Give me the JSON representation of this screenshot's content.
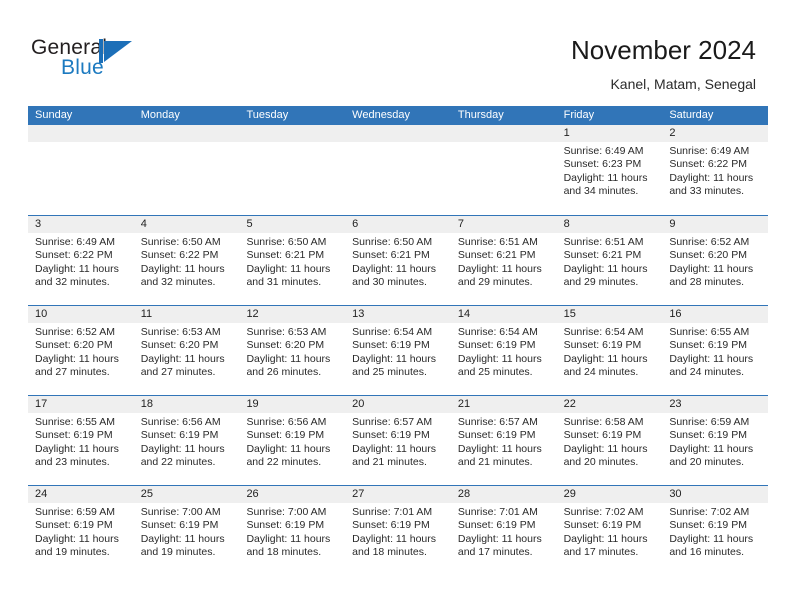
{
  "brand": {
    "name_top": "General",
    "name_bottom": "Blue",
    "mark": "flag-triangle",
    "color_top": "#231f20",
    "color_bottom": "#1c7ac0",
    "accent": "#1c6fb8"
  },
  "header": {
    "title": "November 2024",
    "subtitle": "Kanel, Matam, Senegal",
    "header_bg": "#3175b8",
    "daynum_bg": "#efefef"
  },
  "calendar": {
    "weekday_headers": [
      "Sunday",
      "Monday",
      "Tuesday",
      "Wednesday",
      "Thursday",
      "Friday",
      "Saturday"
    ],
    "weeks": [
      [
        {
          "day": "",
          "sunrise": "",
          "sunset": "",
          "daylight_line1": "",
          "daylight_line2": ""
        },
        {
          "day": "",
          "sunrise": "",
          "sunset": "",
          "daylight_line1": "",
          "daylight_line2": ""
        },
        {
          "day": "",
          "sunrise": "",
          "sunset": "",
          "daylight_line1": "",
          "daylight_line2": ""
        },
        {
          "day": "",
          "sunrise": "",
          "sunset": "",
          "daylight_line1": "",
          "daylight_line2": ""
        },
        {
          "day": "",
          "sunrise": "",
          "sunset": "",
          "daylight_line1": "",
          "daylight_line2": ""
        },
        {
          "day": "1",
          "sunrise": "Sunrise: 6:49 AM",
          "sunset": "Sunset: 6:23 PM",
          "daylight_line1": "Daylight: 11 hours",
          "daylight_line2": "and 34 minutes."
        },
        {
          "day": "2",
          "sunrise": "Sunrise: 6:49 AM",
          "sunset": "Sunset: 6:22 PM",
          "daylight_line1": "Daylight: 11 hours",
          "daylight_line2": "and 33 minutes."
        }
      ],
      [
        {
          "day": "3",
          "sunrise": "Sunrise: 6:49 AM",
          "sunset": "Sunset: 6:22 PM",
          "daylight_line1": "Daylight: 11 hours",
          "daylight_line2": "and 32 minutes."
        },
        {
          "day": "4",
          "sunrise": "Sunrise: 6:50 AM",
          "sunset": "Sunset: 6:22 PM",
          "daylight_line1": "Daylight: 11 hours",
          "daylight_line2": "and 32 minutes."
        },
        {
          "day": "5",
          "sunrise": "Sunrise: 6:50 AM",
          "sunset": "Sunset: 6:21 PM",
          "daylight_line1": "Daylight: 11 hours",
          "daylight_line2": "and 31 minutes."
        },
        {
          "day": "6",
          "sunrise": "Sunrise: 6:50 AM",
          "sunset": "Sunset: 6:21 PM",
          "daylight_line1": "Daylight: 11 hours",
          "daylight_line2": "and 30 minutes."
        },
        {
          "day": "7",
          "sunrise": "Sunrise: 6:51 AM",
          "sunset": "Sunset: 6:21 PM",
          "daylight_line1": "Daylight: 11 hours",
          "daylight_line2": "and 29 minutes."
        },
        {
          "day": "8",
          "sunrise": "Sunrise: 6:51 AM",
          "sunset": "Sunset: 6:21 PM",
          "daylight_line1": "Daylight: 11 hours",
          "daylight_line2": "and 29 minutes."
        },
        {
          "day": "9",
          "sunrise": "Sunrise: 6:52 AM",
          "sunset": "Sunset: 6:20 PM",
          "daylight_line1": "Daylight: 11 hours",
          "daylight_line2": "and 28 minutes."
        }
      ],
      [
        {
          "day": "10",
          "sunrise": "Sunrise: 6:52 AM",
          "sunset": "Sunset: 6:20 PM",
          "daylight_line1": "Daylight: 11 hours",
          "daylight_line2": "and 27 minutes."
        },
        {
          "day": "11",
          "sunrise": "Sunrise: 6:53 AM",
          "sunset": "Sunset: 6:20 PM",
          "daylight_line1": "Daylight: 11 hours",
          "daylight_line2": "and 27 minutes."
        },
        {
          "day": "12",
          "sunrise": "Sunrise: 6:53 AM",
          "sunset": "Sunset: 6:20 PM",
          "daylight_line1": "Daylight: 11 hours",
          "daylight_line2": "and 26 minutes."
        },
        {
          "day": "13",
          "sunrise": "Sunrise: 6:54 AM",
          "sunset": "Sunset: 6:19 PM",
          "daylight_line1": "Daylight: 11 hours",
          "daylight_line2": "and 25 minutes."
        },
        {
          "day": "14",
          "sunrise": "Sunrise: 6:54 AM",
          "sunset": "Sunset: 6:19 PM",
          "daylight_line1": "Daylight: 11 hours",
          "daylight_line2": "and 25 minutes."
        },
        {
          "day": "15",
          "sunrise": "Sunrise: 6:54 AM",
          "sunset": "Sunset: 6:19 PM",
          "daylight_line1": "Daylight: 11 hours",
          "daylight_line2": "and 24 minutes."
        },
        {
          "day": "16",
          "sunrise": "Sunrise: 6:55 AM",
          "sunset": "Sunset: 6:19 PM",
          "daylight_line1": "Daylight: 11 hours",
          "daylight_line2": "and 24 minutes."
        }
      ],
      [
        {
          "day": "17",
          "sunrise": "Sunrise: 6:55 AM",
          "sunset": "Sunset: 6:19 PM",
          "daylight_line1": "Daylight: 11 hours",
          "daylight_line2": "and 23 minutes."
        },
        {
          "day": "18",
          "sunrise": "Sunrise: 6:56 AM",
          "sunset": "Sunset: 6:19 PM",
          "daylight_line1": "Daylight: 11 hours",
          "daylight_line2": "and 22 minutes."
        },
        {
          "day": "19",
          "sunrise": "Sunrise: 6:56 AM",
          "sunset": "Sunset: 6:19 PM",
          "daylight_line1": "Daylight: 11 hours",
          "daylight_line2": "and 22 minutes."
        },
        {
          "day": "20",
          "sunrise": "Sunrise: 6:57 AM",
          "sunset": "Sunset: 6:19 PM",
          "daylight_line1": "Daylight: 11 hours",
          "daylight_line2": "and 21 minutes."
        },
        {
          "day": "21",
          "sunrise": "Sunrise: 6:57 AM",
          "sunset": "Sunset: 6:19 PM",
          "daylight_line1": "Daylight: 11 hours",
          "daylight_line2": "and 21 minutes."
        },
        {
          "day": "22",
          "sunrise": "Sunrise: 6:58 AM",
          "sunset": "Sunset: 6:19 PM",
          "daylight_line1": "Daylight: 11 hours",
          "daylight_line2": "and 20 minutes."
        },
        {
          "day": "23",
          "sunrise": "Sunrise: 6:59 AM",
          "sunset": "Sunset: 6:19 PM",
          "daylight_line1": "Daylight: 11 hours",
          "daylight_line2": "and 20 minutes."
        }
      ],
      [
        {
          "day": "24",
          "sunrise": "Sunrise: 6:59 AM",
          "sunset": "Sunset: 6:19 PM",
          "daylight_line1": "Daylight: 11 hours",
          "daylight_line2": "and 19 minutes."
        },
        {
          "day": "25",
          "sunrise": "Sunrise: 7:00 AM",
          "sunset": "Sunset: 6:19 PM",
          "daylight_line1": "Daylight: 11 hours",
          "daylight_line2": "and 19 minutes."
        },
        {
          "day": "26",
          "sunrise": "Sunrise: 7:00 AM",
          "sunset": "Sunset: 6:19 PM",
          "daylight_line1": "Daylight: 11 hours",
          "daylight_line2": "and 18 minutes."
        },
        {
          "day": "27",
          "sunrise": "Sunrise: 7:01 AM",
          "sunset": "Sunset: 6:19 PM",
          "daylight_line1": "Daylight: 11 hours",
          "daylight_line2": "and 18 minutes."
        },
        {
          "day": "28",
          "sunrise": "Sunrise: 7:01 AM",
          "sunset": "Sunset: 6:19 PM",
          "daylight_line1": "Daylight: 11 hours",
          "daylight_line2": "and 17 minutes."
        },
        {
          "day": "29",
          "sunrise": "Sunrise: 7:02 AM",
          "sunset": "Sunset: 6:19 PM",
          "daylight_line1": "Daylight: 11 hours",
          "daylight_line2": "and 17 minutes."
        },
        {
          "day": "30",
          "sunrise": "Sunrise: 7:02 AM",
          "sunset": "Sunset: 6:19 PM",
          "daylight_line1": "Daylight: 11 hours",
          "daylight_line2": "and 16 minutes."
        }
      ]
    ]
  }
}
